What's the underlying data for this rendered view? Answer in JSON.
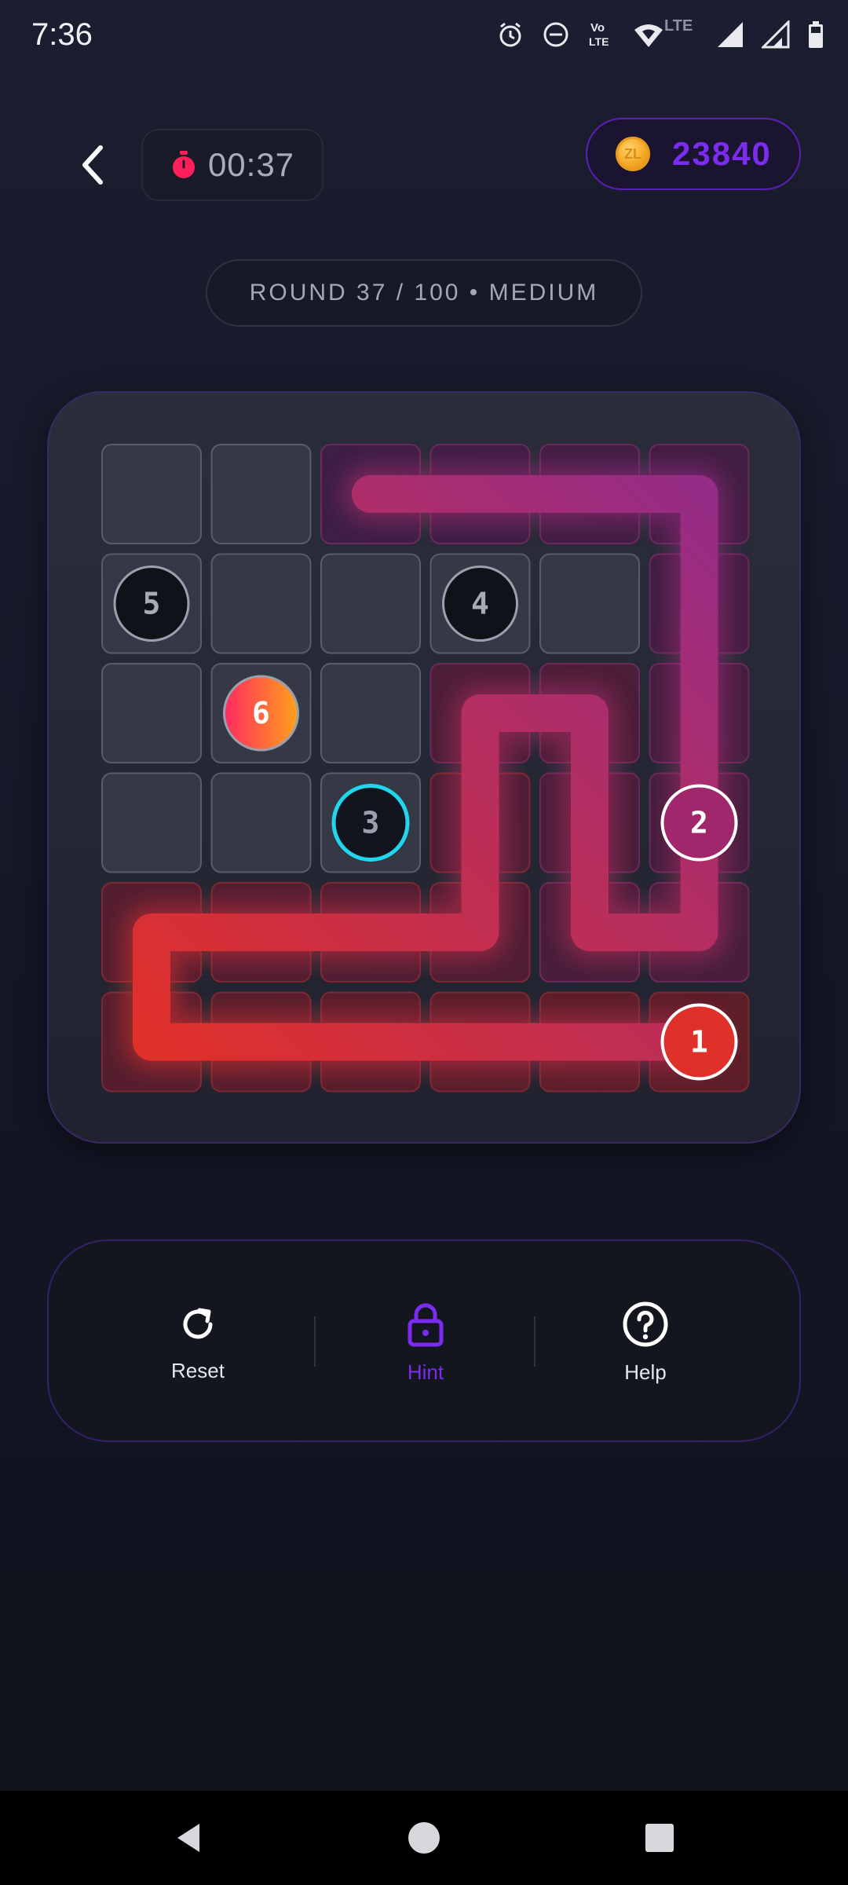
{
  "status_bar": {
    "time": "7:36",
    "icons": [
      "alarm-icon",
      "dnd-icon",
      "volte-icon",
      "wifi-icon",
      "lte-label",
      "signal-icon",
      "signal-icon-2",
      "battery-icon"
    ],
    "lte_text": "LTE",
    "volte_text_top": "Vo",
    "volte_text_bottom": "LTE"
  },
  "header": {
    "back_icon": "chevron-left-icon",
    "timer": {
      "icon": "stopwatch-icon",
      "value": "00:37"
    },
    "coins": {
      "icon": "coin-icon",
      "coin_symbol": "ZL",
      "amount": "23840"
    }
  },
  "round_label": "ROUND 37 / 100 • MEDIUM",
  "board": {
    "rows": 6,
    "cols": 6,
    "path_color_start": "#e0302a",
    "path_color_end": "#962c86",
    "path_cells": [
      [
        5,
        5
      ],
      [
        5,
        4
      ],
      [
        5,
        3
      ],
      [
        5,
        2
      ],
      [
        5,
        1
      ],
      [
        5,
        0
      ],
      [
        4,
        0
      ],
      [
        4,
        1
      ],
      [
        4,
        2
      ],
      [
        4,
        3
      ],
      [
        3,
        3
      ],
      [
        2,
        3
      ],
      [
        2,
        4
      ],
      [
        3,
        4
      ],
      [
        4,
        4
      ],
      [
        4,
        5
      ],
      [
        3,
        5
      ],
      [
        2,
        5
      ],
      [
        1,
        5
      ],
      [
        0,
        5
      ],
      [
        0,
        4
      ],
      [
        0,
        3
      ],
      [
        0,
        2
      ]
    ],
    "nodes": [
      {
        "label": "1",
        "row": 5,
        "col": 5,
        "style": "active-red"
      },
      {
        "label": "2",
        "row": 3,
        "col": 5,
        "style": "visited"
      },
      {
        "label": "3",
        "row": 3,
        "col": 2,
        "style": "next-target"
      },
      {
        "label": "4",
        "row": 1,
        "col": 3,
        "style": "unvisited"
      },
      {
        "label": "5",
        "row": 1,
        "col": 0,
        "style": "unvisited"
      },
      {
        "label": "6",
        "row": 2,
        "col": 1,
        "style": "goal"
      }
    ]
  },
  "actions": [
    {
      "label": "Reset",
      "icon": "refresh-icon"
    },
    {
      "label": "Hint",
      "icon": "lock-icon"
    },
    {
      "label": "Help",
      "icon": "help-circle-icon"
    }
  ],
  "colors": {
    "accent": "#7c2bf0",
    "timer_icon": "#ff1f5a",
    "target_ring": "#1fd6ec"
  },
  "nav": {
    "back": "nav-back-icon",
    "home": "nav-home-icon",
    "recents": "nav-recents-icon"
  }
}
